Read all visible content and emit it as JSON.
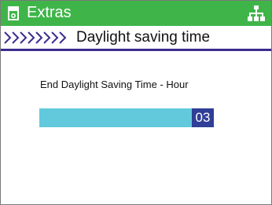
{
  "titlebar": {
    "title": "Extras",
    "icon": "phone-device-icon",
    "right_icon": "network-topology-icon",
    "color": "#3fb549"
  },
  "subtitle": {
    "icon": "chevrons-right-icon",
    "text": "Daylight saving time"
  },
  "field": {
    "label": "End Daylight Saving Time - Hour",
    "value": "03",
    "bar_color": "#62c9dc",
    "cursor_color": "#2f3e96"
  }
}
